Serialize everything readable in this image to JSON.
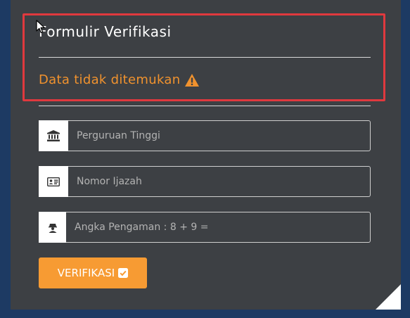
{
  "form": {
    "title": "Formulir Verifikasi",
    "error_message": "Data tidak ditemukan",
    "fields": [
      {
        "icon": "institution-icon",
        "placeholder": "Perguruan Tinggi",
        "value": ""
      },
      {
        "icon": "id-card-icon",
        "placeholder": "Nomor Ijazah",
        "value": ""
      },
      {
        "icon": "security-icon",
        "placeholder": "Angka Pengaman : 8 + 9 =",
        "value": ""
      }
    ],
    "submit_label": "VERIFIKASI"
  },
  "colors": {
    "page_background": "#1d3a63",
    "panel_background": "#3d4044",
    "accent": "#f79b33",
    "error_text": "#f0922e",
    "highlight_border": "#e0393e"
  }
}
